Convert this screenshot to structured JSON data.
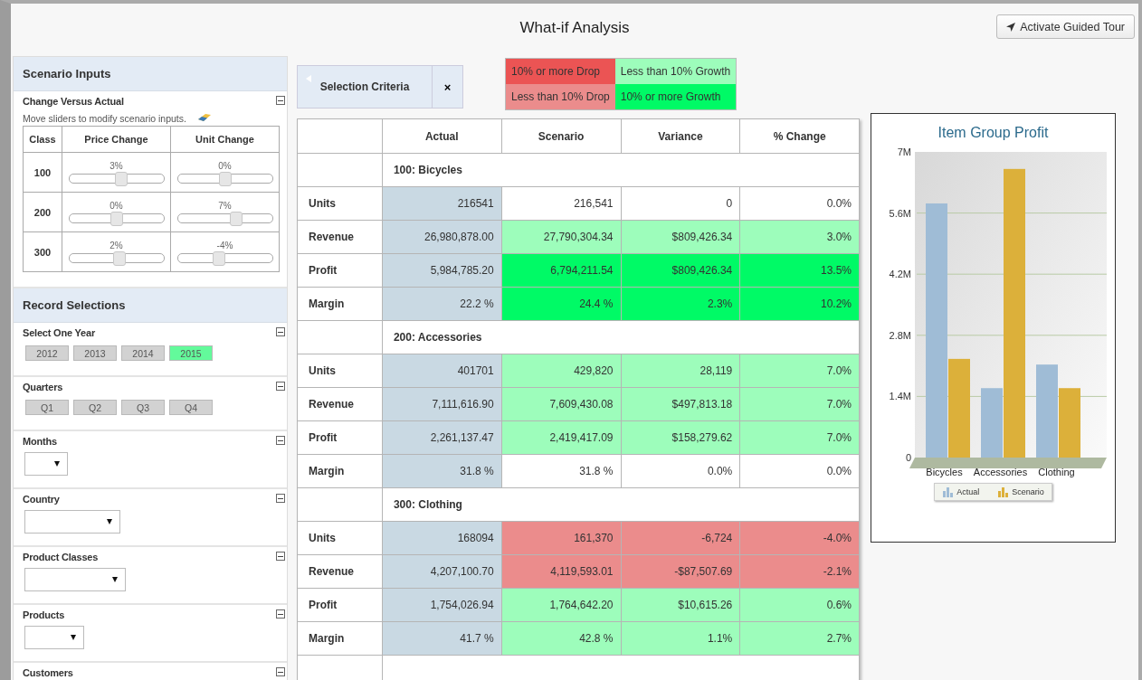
{
  "header": {
    "title": "What-if Analysis",
    "tour_button": "Activate Guided Tour"
  },
  "scenario_inputs": {
    "title": "Scenario Inputs",
    "section": {
      "title": "Change Versus Actual",
      "hint": "Move sliders to modify scenario inputs.",
      "columns": [
        "Class",
        "Price Change",
        "Unit Change"
      ],
      "rows": [
        {
          "class": "100",
          "price": {
            "reading": "3%",
            "level": 0.55
          },
          "unit": {
            "reading": "0%",
            "level": 0.5
          }
        },
        {
          "class": "200",
          "price": {
            "reading": "0%",
            "level": 0.5
          },
          "unit": {
            "reading": "7%",
            "level": 0.62
          }
        },
        {
          "class": "300",
          "price": {
            "reading": "2%",
            "level": 0.53
          },
          "unit": {
            "reading": "-4%",
            "level": 0.44
          }
        }
      ]
    }
  },
  "record_selections": {
    "title": "Record Selections",
    "sections": [
      {
        "title": "Select One Year",
        "kind": "buttons",
        "options": [
          {
            "label": "2012",
            "selected": false
          },
          {
            "label": "2013",
            "selected": false
          },
          {
            "label": "2014",
            "selected": false
          },
          {
            "label": "2015",
            "selected": true
          }
        ]
      },
      {
        "title": "Quarters",
        "kind": "buttons",
        "options": [
          {
            "label": "Q1",
            "selected": false
          },
          {
            "label": "Q2",
            "selected": false
          },
          {
            "label": "Q3",
            "selected": false
          },
          {
            "label": "Q4",
            "selected": false
          }
        ]
      },
      {
        "title": "Months",
        "kind": "dropdown"
      },
      {
        "title": "Country",
        "kind": "dropdown"
      },
      {
        "title": "Product Classes",
        "kind": "dropdown"
      },
      {
        "title": "Products",
        "kind": "dropdown"
      },
      {
        "title": "Customers",
        "kind": "header"
      }
    ]
  },
  "selection_criteria": {
    "label": "Selection Criteria",
    "close": "×"
  },
  "legend": [
    {
      "label": "10% or more Drop",
      "color": "#eb5454"
    },
    {
      "label": "Less than 10% Growth",
      "color": "#9dfdbb"
    },
    {
      "label": "Less than 10% Drop",
      "color": "#eb8c8c"
    },
    {
      "label": "10% or more Growth",
      "color": "#00fa66"
    }
  ],
  "table": {
    "columns": [
      "Actual",
      "Scenario",
      "Variance",
      "% Change"
    ],
    "groups": [
      {
        "title": "100: Bicycles",
        "rows": [
          {
            "label": "Units",
            "cells": [
              {
                "text": "216541",
                "color": "#c9d9e3"
              },
              {
                "text": "216,541",
                "color": "#ffffff"
              },
              {
                "text": "0",
                "color": "#ffffff"
              },
              {
                "text": "0.0%",
                "color": "#ffffff"
              }
            ]
          },
          {
            "label": "Revenue",
            "cells": [
              {
                "text": "26,980,878.00",
                "color": "#c9d9e3"
              },
              {
                "text": "27,790,304.34",
                "color": "#9dfdbb"
              },
              {
                "text": "$809,426.34",
                "color": "#9dfdbb"
              },
              {
                "text": "3.0%",
                "color": "#9dfdbb"
              }
            ]
          },
          {
            "label": "Profit",
            "cells": [
              {
                "text": "5,984,785.20",
                "color": "#c9d9e3"
              },
              {
                "text": "6,794,211.54",
                "color": "#00fa66"
              },
              {
                "text": "$809,426.34",
                "color": "#00fa66"
              },
              {
                "text": "13.5%",
                "color": "#00fa66"
              }
            ]
          },
          {
            "label": "Margin",
            "cells": [
              {
                "text": "22.2 %",
                "color": "#c9d9e3"
              },
              {
                "text": "24.4 %",
                "color": "#00fa66"
              },
              {
                "text": "2.3%",
                "color": "#00fa66"
              },
              {
                "text": "10.2%",
                "color": "#00fa66"
              }
            ]
          }
        ]
      },
      {
        "title": "200: Accessories",
        "rows": [
          {
            "label": "Units",
            "cells": [
              {
                "text": "401701",
                "color": "#c9d9e3"
              },
              {
                "text": "429,820",
                "color": "#9dfdbb"
              },
              {
                "text": "28,119",
                "color": "#9dfdbb"
              },
              {
                "text": "7.0%",
                "color": "#9dfdbb"
              }
            ]
          },
          {
            "label": "Revenue",
            "cells": [
              {
                "text": "7,111,616.90",
                "color": "#c9d9e3"
              },
              {
                "text": "7,609,430.08",
                "color": "#9dfdbb"
              },
              {
                "text": "$497,813.18",
                "color": "#9dfdbb"
              },
              {
                "text": "7.0%",
                "color": "#9dfdbb"
              }
            ]
          },
          {
            "label": "Profit",
            "cells": [
              {
                "text": "2,261,137.47",
                "color": "#c9d9e3"
              },
              {
                "text": "2,419,417.09",
                "color": "#9dfdbb"
              },
              {
                "text": "$158,279.62",
                "color": "#9dfdbb"
              },
              {
                "text": "7.0%",
                "color": "#9dfdbb"
              }
            ]
          },
          {
            "label": "Margin",
            "cells": [
              {
                "text": "31.8 %",
                "color": "#c9d9e3"
              },
              {
                "text": "31.8 %",
                "color": "#ffffff"
              },
              {
                "text": "0.0%",
                "color": "#ffffff"
              },
              {
                "text": "0.0%",
                "color": "#ffffff"
              }
            ]
          }
        ]
      },
      {
        "title": "300: Clothing",
        "rows": [
          {
            "label": "Units",
            "cells": [
              {
                "text": "168094",
                "color": "#c9d9e3"
              },
              {
                "text": "161,370",
                "color": "#eb8c8c"
              },
              {
                "text": "-6,724",
                "color": "#eb8c8c"
              },
              {
                "text": "-4.0%",
                "color": "#eb8c8c"
              }
            ]
          },
          {
            "label": "Revenue",
            "cells": [
              {
                "text": "4,207,100.70",
                "color": "#c9d9e3"
              },
              {
                "text": "4,119,593.01",
                "color": "#eb8c8c"
              },
              {
                "text": "-$87,507.69",
                "color": "#eb8c8c"
              },
              {
                "text": "-2.1%",
                "color": "#eb8c8c"
              }
            ]
          },
          {
            "label": "Profit",
            "cells": [
              {
                "text": "1,754,026.94",
                "color": "#c9d9e3"
              },
              {
                "text": "1,764,642.20",
                "color": "#9dfdbb"
              },
              {
                "text": "$10,615.26",
                "color": "#9dfdbb"
              },
              {
                "text": "0.6%",
                "color": "#9dfdbb"
              }
            ]
          },
          {
            "label": "Margin",
            "cells": [
              {
                "text": "41.7 %",
                "color": "#c9d9e3"
              },
              {
                "text": "42.8 %",
                "color": "#9dfdbb"
              },
              {
                "text": "1.1%",
                "color": "#9dfdbb"
              },
              {
                "text": "2.7%",
                "color": "#9dfdbb"
              }
            ]
          }
        ]
      }
    ]
  },
  "chart": {
    "chart_data": {
      "type": "bar",
      "title": "Item Group Profit",
      "categories": [
        "Bicycles",
        "Accessories",
        "Clothing"
      ],
      "series": [
        {
          "name": "Actual",
          "color": "#9fbcd6",
          "values": [
            5820000,
            1590000,
            2130000
          ]
        },
        {
          "name": "Scenario",
          "color": "#dcb03a",
          "values": [
            2260000,
            6610000,
            1590000
          ]
        }
      ],
      "ylim": [
        0,
        7000000
      ],
      "grid": true,
      "legend": true,
      "yticks": [
        {
          "value": 0,
          "label": "0"
        },
        {
          "value": 1400000,
          "label": "1.4M"
        },
        {
          "value": 2800000,
          "label": "2.8M"
        },
        {
          "value": 4200000,
          "label": "4.2M"
        },
        {
          "value": 5600000,
          "label": "5.6M"
        },
        {
          "value": 7000000,
          "label": "7M"
        }
      ]
    }
  }
}
